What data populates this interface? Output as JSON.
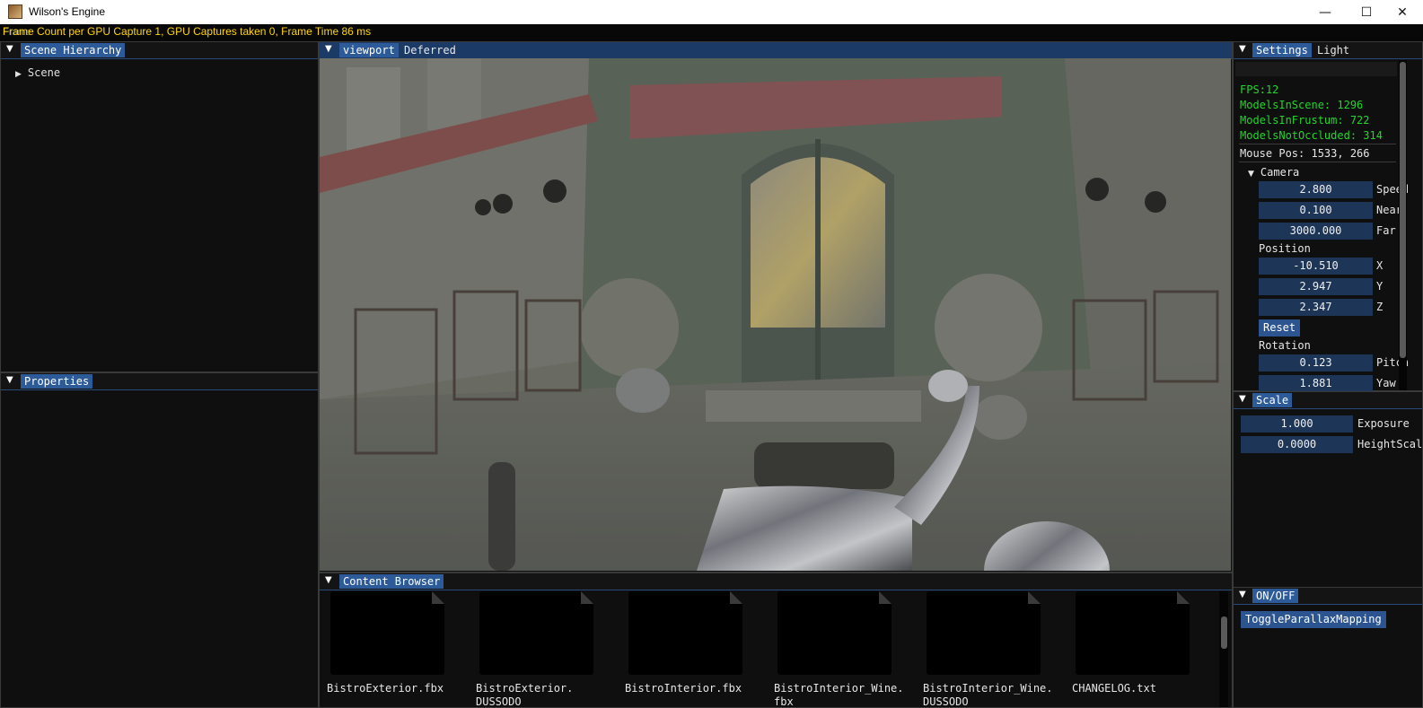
{
  "window": {
    "title": "Wilson's Engine",
    "controls": {
      "minimize": "—",
      "maximize": "☐",
      "close": "✕"
    }
  },
  "overlay": {
    "frame_info": "Frame Count per GPU Capture 1, GPU Captures taken 0, Frame Time 86 ms",
    "ghost_label": "Frame"
  },
  "scene_hierarchy": {
    "tab": "Scene Hierarchy",
    "items": [
      {
        "label": "Scene"
      }
    ]
  },
  "properties": {
    "tab": "Properties"
  },
  "viewport": {
    "tabs": [
      "viewport",
      "Deferred"
    ]
  },
  "settings": {
    "tabs": [
      "Settings",
      "Light"
    ],
    "stats": {
      "fps": "FPS:12",
      "models_in_scene": "ModelsInScene: 1296",
      "models_in_frustum": "ModelsInFrustum: 722",
      "models_not_occluded": "ModelsNotOccluded: 314"
    },
    "mouse_pos": "Mouse Pos: 1533, 266",
    "camera": {
      "header": "Camera",
      "speed": {
        "value": "2.800",
        "label": "Speed"
      },
      "near": {
        "value": "0.100",
        "label": "Near"
      },
      "far": {
        "value": "3000.000",
        "label": "Far"
      },
      "position_label": "Position",
      "x": {
        "value": "-10.510",
        "label": "X"
      },
      "y": {
        "value": "2.947",
        "label": "Y"
      },
      "z": {
        "value": "2.347",
        "label": "Z"
      },
      "reset_label": "Reset",
      "rotation_label": "Rotation",
      "pitch": {
        "value": "0.123",
        "label": "Pitch"
      },
      "yaw": {
        "value": "1.881",
        "label": "Yaw"
      }
    }
  },
  "scale": {
    "tab": "Scale",
    "exposure": {
      "value": "1.000",
      "label": "Exposure"
    },
    "height_scale": {
      "value": "0.0000",
      "label": "HeightScale"
    }
  },
  "onoff": {
    "tab": "ON/OFF",
    "toggle_parallax": "ToggleParallaxMapping"
  },
  "content_browser": {
    "tab": "Content Browser",
    "files": [
      {
        "name": "BistroExterior.fbx",
        "name2": ""
      },
      {
        "name": "BistroExterior.",
        "name2": "DUSSODO"
      },
      {
        "name": "BistroInterior.fbx",
        "name2": ""
      },
      {
        "name": "BistroInterior_Wine.",
        "name2": "fbx"
      },
      {
        "name": "BistroInterior_Wine.",
        "name2": "DUSSODO"
      },
      {
        "name": "CHANGELOG.txt",
        "name2": ""
      }
    ]
  },
  "colors": {
    "accent_tab": "#2d5a99",
    "stats_green": "#22d62a",
    "frame_info_yellow": "#ffd700",
    "field_bg": "#1d3557"
  }
}
